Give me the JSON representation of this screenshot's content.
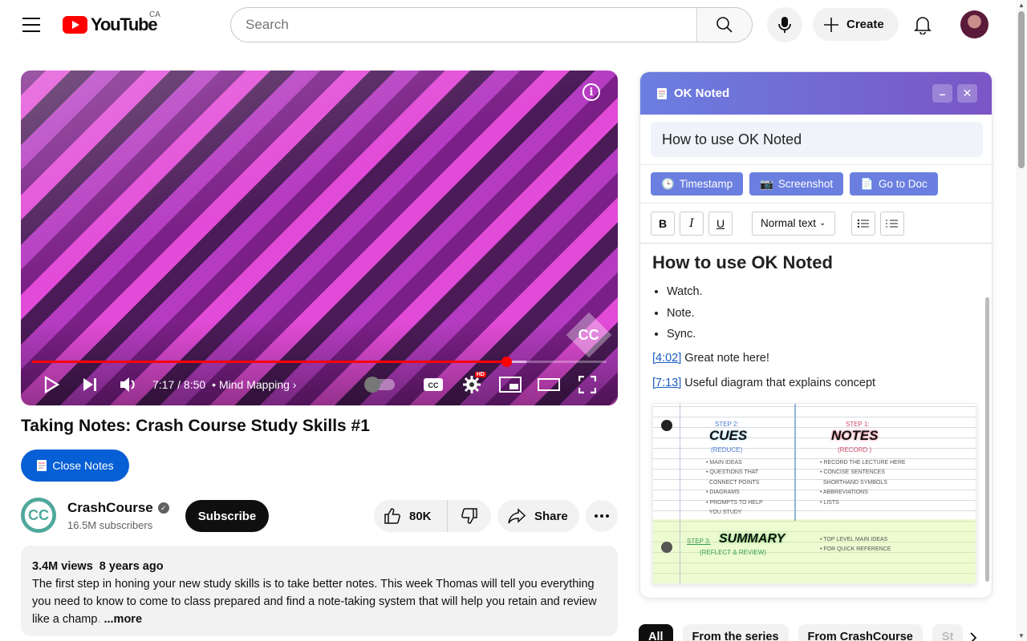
{
  "header": {
    "logo_text": "YouTube",
    "region": "CA",
    "search_placeholder": "Search",
    "create_label": "Create"
  },
  "player": {
    "time": "7:17 / 8:50",
    "chapter": "Mind Mapping",
    "progress_fraction": 0.825,
    "buffer_fraction": 0.86,
    "cc_label": "CC",
    "hd_label": "HD",
    "info_label": "i"
  },
  "video": {
    "title": "Taking Notes: Crash Course Study Skills #1",
    "close_notes_label": "Close Notes",
    "channel_name": "CrashCourse",
    "channel_initials": "CC",
    "subscribers": "16.5M subscribers",
    "subscribe_label": "Subscribe",
    "likes": "80K",
    "share_label": "Share",
    "views": "3.4M views",
    "age": "8 years ago",
    "description_main": "The first step in honing your new study skills is to take better notes. This week Thomas will tell you everything you need to know to come to class prepared and find a note-taking system that will help you retain and review like a champ",
    "description_fade": ".",
    "more_label": "...more"
  },
  "notes": {
    "app_title": "OK Noted",
    "doc_title": "How to use OK Noted",
    "actions": [
      "Timestamp",
      "Screenshot",
      "Go to Doc"
    ],
    "format_select": "Normal text",
    "heading": "How to use OK Noted",
    "bullets": [
      "Watch.",
      "Note.",
      "Sync."
    ],
    "entries": [
      {
        "timestamp": "[4:02]",
        "text": " Great note here!"
      },
      {
        "timestamp": "[7:13]",
        "text": " Useful diagram that explains concept"
      }
    ],
    "diagram": {
      "step2_label": "STEP 2:",
      "step2_title": "CUES",
      "step2_sub": "(REDUCE)",
      "step1_label": "STEP 1:",
      "step1_title": "NOTES",
      "step1_sub": "(RECORD )",
      "cues_items": "• MAIN IDEAS\n• QUESTIONS THAT\n  CONNECT POINTS\n• DIAGRAMS\n• PROMPTS TO HELP\n  YOU STUDY",
      "notes_items": "• RECORD THE LECTURE HERE\n• CONCISE SENTENCES\n  SHORTHAND SYMBOLS\n• ABBREVIATIONS\n• LISTS",
      "step3_label": "STEP 3:",
      "step3_title": "SUMMARY",
      "step3_sub": "(REFLECT & REVIEW)",
      "summary_items": "• TOP LEVEL MAIN IDEAS\n• FOR QUICK REFERENCE"
    }
  },
  "chips": [
    "All",
    "From the series",
    "From CrashCourse",
    "St"
  ]
}
